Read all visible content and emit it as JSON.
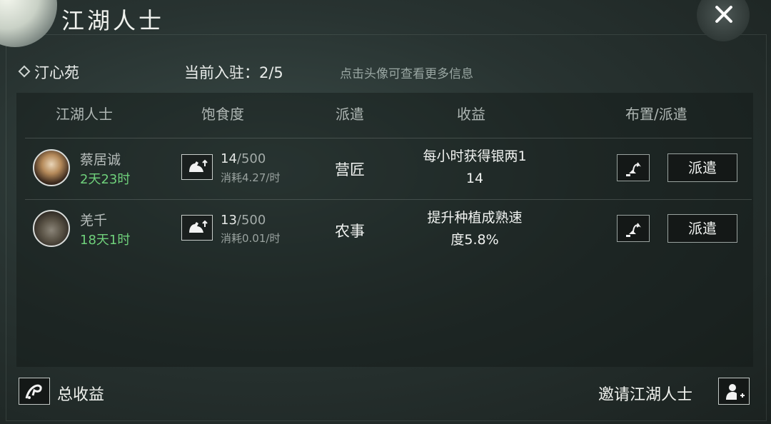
{
  "title": "江湖人士",
  "location": {
    "name": "汀心苑",
    "count_label": "当前入驻：2/5",
    "hint": "点击头像可查看更多信息"
  },
  "columns": [
    "江湖人士",
    "饱食度",
    "派遣",
    "收益",
    "布置/派遣"
  ],
  "rows": [
    {
      "name": "蔡居诚",
      "time": "2天23时",
      "food_current": "14",
      "food_max": "/500",
      "consume": "消耗4.27/时",
      "job": "营匠",
      "income_line1": "每小时获得银两1",
      "income_line2": "14",
      "dispatch_label": "派遣"
    },
    {
      "name": "羌千",
      "time": "18天1时",
      "food_current": "13",
      "food_max": "/500",
      "consume": "消耗0.01/时",
      "job": "农事",
      "income_line1": "提升种植成熟速",
      "income_line2": "度5.8%",
      "dispatch_label": "派遣"
    }
  ],
  "footer": {
    "total_label": "总收益",
    "invite_label": "邀请江湖人士"
  },
  "colors": {
    "accent_green": "#6fd07b",
    "background": "#283331"
  },
  "icons": [
    "close-icon",
    "diamond-icon",
    "stamina-icon",
    "placement-icon",
    "income-icon",
    "add-user-icon"
  ]
}
